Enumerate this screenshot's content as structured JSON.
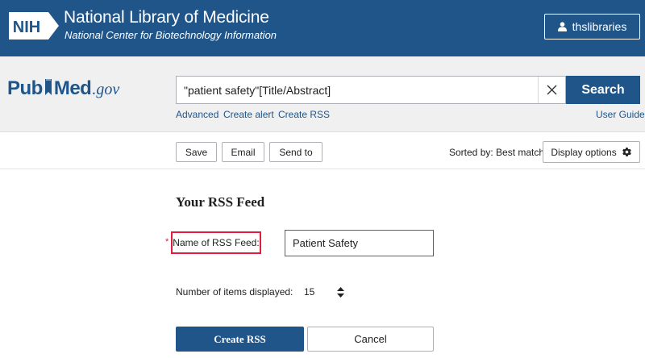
{
  "header": {
    "logo_text": "NIH",
    "title": "National Library of Medicine",
    "subtitle": "National Center for Biotechnology Information",
    "user_button_label": "thslibraries"
  },
  "search": {
    "logo_pub": "Pub",
    "logo_med": "Med",
    "logo_gov": ".gov",
    "query": "\"patient safety\"[Title/Abstract]",
    "search_button_label": "Search",
    "links": {
      "advanced": "Advanced",
      "create_alert": "Create alert",
      "create_rss": "Create RSS",
      "user_guide": "User Guide"
    }
  },
  "toolbar": {
    "save_label": "Save",
    "email_label": "Email",
    "send_to_label": "Send to",
    "sorted_by": "Sorted by: Best match",
    "display_options_label": "Display options"
  },
  "rss_form": {
    "title": "Your RSS Feed",
    "required_marker": "*",
    "name_label": "Name of RSS Feed:",
    "name_value": "Patient Safety",
    "items_label": "Number of items displayed:",
    "items_value": "15",
    "create_label": "Create RSS",
    "cancel_label": "Cancel"
  },
  "colors": {
    "brand_blue": "#20558a",
    "highlight_red": "#e31c3d",
    "search_area_bg": "#f0f0f0"
  },
  "icons": {
    "user": "user-icon",
    "clear": "close-icon",
    "display": "gear-icon",
    "stepper": "sort-arrows-icon"
  }
}
